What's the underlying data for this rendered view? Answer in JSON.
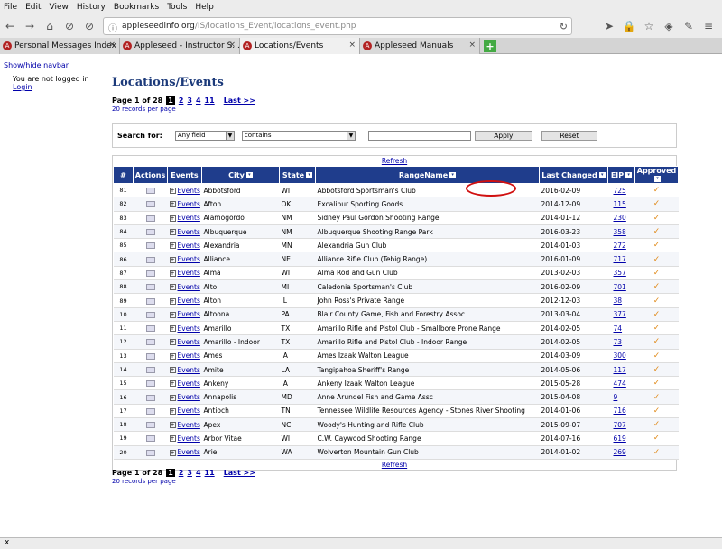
{
  "menu": [
    "File",
    "Edit",
    "View",
    "History",
    "Bookmarks",
    "Tools",
    "Help"
  ],
  "url": {
    "host": "appleseedinfo.org",
    "path": "/IS/locations_Event/locations_event.php"
  },
  "tabs": [
    {
      "label": "Personal Messages Index",
      "active": false
    },
    {
      "label": "Appleseed - Instructor S...",
      "active": false
    },
    {
      "label": "Locations/Events",
      "active": true
    },
    {
      "label": "Appleseed Manuals",
      "active": false
    }
  ],
  "sidebar": {
    "toggle": "Show/hide navbar",
    "status": "You are not logged in",
    "login": "Login"
  },
  "page": {
    "title": "Locations/Events",
    "pager_prefix": "Page 1 of 28",
    "current_page": "1",
    "pages": [
      "2",
      "3",
      "4",
      "11"
    ],
    "last": "Last >>",
    "records_per_page": "20 records per page"
  },
  "search": {
    "label": "Search for:",
    "field": "Any field",
    "operator": "contains",
    "value": "",
    "apply": "Apply",
    "reset": "Reset"
  },
  "grid": {
    "refresh": "Refresh",
    "columns": [
      "#",
      "Actions",
      "Events",
      "City",
      "State",
      "RangeName",
      "Last Changed",
      "EIP",
      "Approved"
    ],
    "event_link": "Events",
    "approved_mark": "✓",
    "rows": [
      [
        "81",
        "Abbotsford",
        "WI",
        "Abbotsford Sportsman's Club",
        "2016-02-09",
        "725"
      ],
      [
        "82",
        "Afton",
        "OK",
        "Excalibur Sporting Goods",
        "2014-12-09",
        "115"
      ],
      [
        "83",
        "Alamogordo",
        "NM",
        "Sidney Paul Gordon Shooting Range",
        "2014-01-12",
        "230"
      ],
      [
        "84",
        "Albuquerque",
        "NM",
        "Albuquerque Shooting Range Park",
        "2016-03-23",
        "358"
      ],
      [
        "85",
        "Alexandria",
        "MN",
        "Alexandria Gun Club",
        "2014-01-03",
        "272"
      ],
      [
        "86",
        "Alliance",
        "NE",
        "Alliance Rifle Club (Tebig Range)",
        "2016-01-09",
        "717"
      ],
      [
        "87",
        "Alma",
        "WI",
        "Alma Rod and Gun Club",
        "2013-02-03",
        "357"
      ],
      [
        "88",
        "Alto",
        "MI",
        "Caledonia Sportsman's Club",
        "2016-02-09",
        "701"
      ],
      [
        "89",
        "Alton",
        "IL",
        "John Ross's Private Range",
        "2012-12-03",
        "38"
      ],
      [
        "10",
        "Altoona",
        "PA",
        "Blair County Game, Fish and Forestry Assoc.",
        "2013-03-04",
        "377"
      ],
      [
        "11",
        "Amarillo",
        "TX",
        "Amarillo Rifle and Pistol Club - Smallbore Prone Range",
        "2014-02-05",
        "74"
      ],
      [
        "12",
        "Amarillo - Indoor",
        "TX",
        "Amarillo Rifle and Pistol Club - Indoor Range",
        "2014-02-05",
        "73"
      ],
      [
        "13",
        "Ames",
        "IA",
        "Ames Izaak Walton League",
        "2014-03-09",
        "300"
      ],
      [
        "14",
        "Amite",
        "LA",
        "Tangipahoa Sheriff's Range",
        "2014-05-06",
        "117"
      ],
      [
        "15",
        "Ankeny",
        "IA",
        "Ankeny Izaak Walton League",
        "2015-05-28",
        "474"
      ],
      [
        "16",
        "Annapolis",
        "MD",
        "Anne Arundel Fish and Game Assc",
        "2015-04-08",
        "9"
      ],
      [
        "17",
        "Antioch",
        "TN",
        "Tennessee Wildlife Resources Agency - Stones River Shooting",
        "2014-01-06",
        "716"
      ],
      [
        "18",
        "Apex",
        "NC",
        "Woody's Hunting and Rifle Club",
        "2015-09-07",
        "707"
      ],
      [
        "19",
        "Arbor Vitae",
        "WI",
        "C.W. Caywood Shooting Range",
        "2014-07-16",
        "619"
      ],
      [
        "20",
        "Ariel",
        "WA",
        "Wolverton Mountain Gun Club",
        "2014-01-02",
        "269"
      ]
    ]
  },
  "status": "x"
}
